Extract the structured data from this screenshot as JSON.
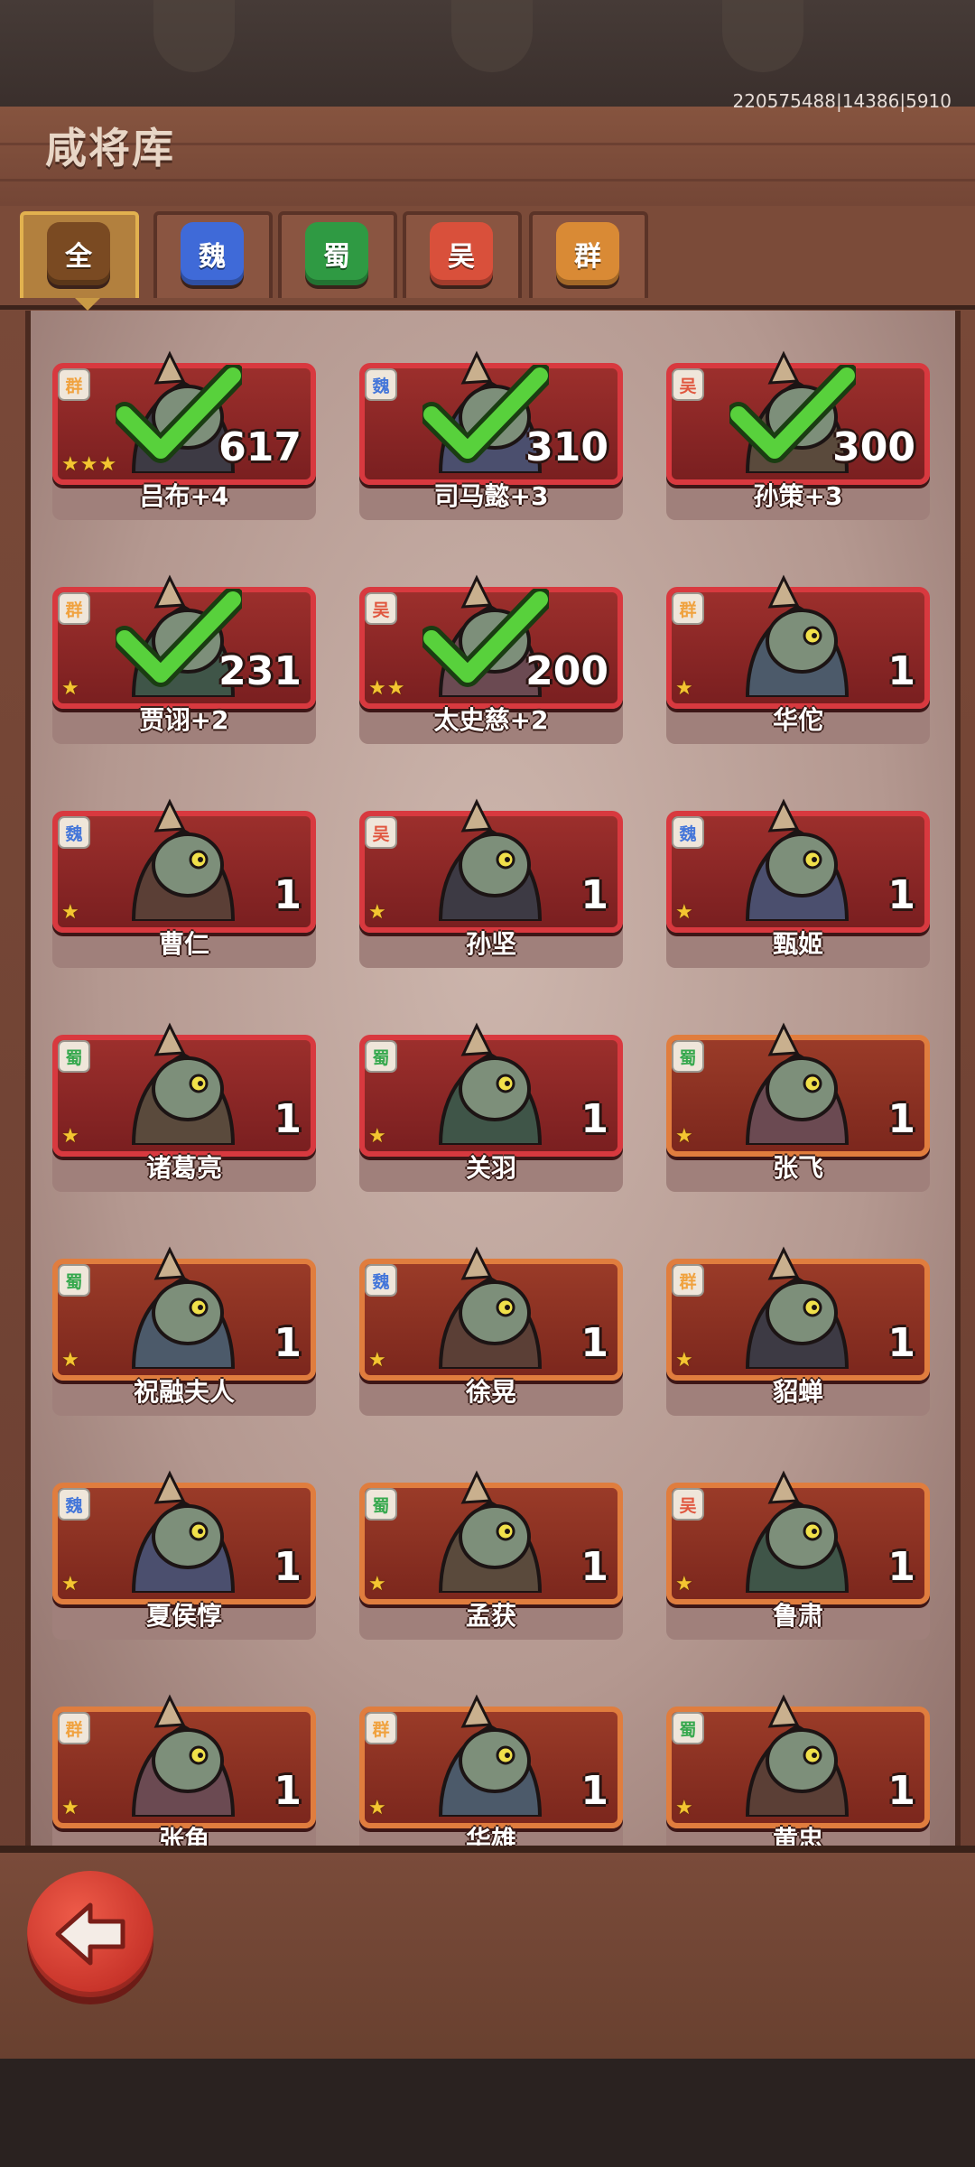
{
  "header": {
    "title": "咸将库",
    "ids": "220575488|14386|5910"
  },
  "tabs": [
    {
      "label": "全",
      "color": "#7a4a22",
      "active": true
    },
    {
      "label": "魏",
      "color": "#3f6ad8",
      "active": false
    },
    {
      "label": "蜀",
      "color": "#2f9a43",
      "active": false
    },
    {
      "label": "吴",
      "color": "#d9503b",
      "active": false
    },
    {
      "label": "群",
      "color": "#d98a35",
      "active": false
    }
  ],
  "faction_colors": {
    "群": "#f0a23f",
    "魏": "#4476d9",
    "蜀": "#36a84d",
    "吴": "#e0573f"
  },
  "generals": [
    {
      "name": "吕布+4",
      "faction": "群",
      "count": "617",
      "stars": 3,
      "collected": true,
      "frame": "red"
    },
    {
      "name": "司马懿+3",
      "faction": "魏",
      "count": "310",
      "stars": 0,
      "collected": true,
      "frame": "red"
    },
    {
      "name": "孙策+3",
      "faction": "吴",
      "count": "300",
      "stars": 0,
      "collected": true,
      "frame": "red"
    },
    {
      "name": "贾诩+2",
      "faction": "群",
      "count": "231",
      "stars": 1,
      "collected": true,
      "frame": "red"
    },
    {
      "name": "太史慈+2",
      "faction": "吴",
      "count": "200",
      "stars": 2,
      "collected": true,
      "frame": "red"
    },
    {
      "name": "华佗",
      "faction": "群",
      "count": "1",
      "stars": 1,
      "collected": false,
      "frame": "red"
    },
    {
      "name": "曹仁",
      "faction": "魏",
      "count": "1",
      "stars": 1,
      "collected": false,
      "frame": "red"
    },
    {
      "name": "孙坚",
      "faction": "吴",
      "count": "1",
      "stars": 1,
      "collected": false,
      "frame": "red"
    },
    {
      "name": "甄姬",
      "faction": "魏",
      "count": "1",
      "stars": 1,
      "collected": false,
      "frame": "red"
    },
    {
      "name": "诸葛亮",
      "faction": "蜀",
      "count": "1",
      "stars": 1,
      "collected": false,
      "frame": "red"
    },
    {
      "name": "关羽",
      "faction": "蜀",
      "count": "1",
      "stars": 1,
      "collected": false,
      "frame": "red"
    },
    {
      "name": "张飞",
      "faction": "蜀",
      "count": "1",
      "stars": 1,
      "collected": false,
      "frame": "orange"
    },
    {
      "name": "祝融夫人",
      "faction": "蜀",
      "count": "1",
      "stars": 1,
      "collected": false,
      "frame": "orange"
    },
    {
      "name": "徐晃",
      "faction": "魏",
      "count": "1",
      "stars": 1,
      "collected": false,
      "frame": "orange"
    },
    {
      "name": "貂蝉",
      "faction": "群",
      "count": "1",
      "stars": 1,
      "collected": false,
      "frame": "orange"
    },
    {
      "name": "夏侯惇",
      "faction": "魏",
      "count": "1",
      "stars": 1,
      "collected": false,
      "frame": "orange"
    },
    {
      "name": "孟获",
      "faction": "蜀",
      "count": "1",
      "stars": 1,
      "collected": false,
      "frame": "orange"
    },
    {
      "name": "鲁肃",
      "faction": "吴",
      "count": "1",
      "stars": 1,
      "collected": false,
      "frame": "orange"
    },
    {
      "name": "张角",
      "faction": "群",
      "count": "1",
      "stars": 1,
      "collected": false,
      "frame": "orange"
    },
    {
      "name": "华雄",
      "faction": "群",
      "count": "1",
      "stars": 1,
      "collected": false,
      "frame": "orange"
    },
    {
      "name": "黄忠",
      "faction": "蜀",
      "count": "1",
      "stars": 1,
      "collected": false,
      "frame": "orange"
    }
  ],
  "footer": {
    "back_icon": "back-arrow-icon"
  }
}
